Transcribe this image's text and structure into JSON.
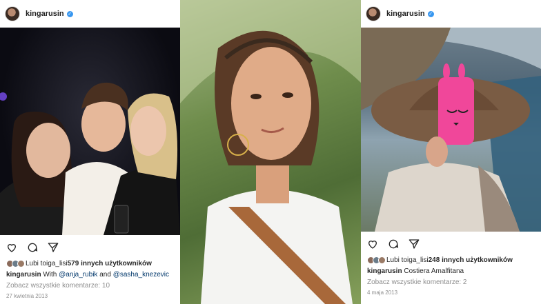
{
  "left_post": {
    "username": "kingarusin",
    "likes": {
      "prefix": "Lubi to ",
      "first_liker": "iga_lis",
      "joiner": " i ",
      "others": "579 innych użytkowników"
    },
    "caption": {
      "user": "kingarusin",
      "text": " With ",
      "mention1": "@anja_rubik",
      "and": " and ",
      "mention2": "@sasha_knezevic"
    },
    "comments": "Zobacz wszystkie komentarze: 10",
    "date": "27 kwietnia 2013"
  },
  "right_post": {
    "username": "kingarusin",
    "likes": {
      "prefix": "Lubi to ",
      "first_liker": "iga_lis",
      "joiner": " i ",
      "others": "248 innych użytkowników"
    },
    "caption": {
      "user": "kingarusin",
      "text": " Costiera Amalfitana"
    },
    "comments": "Zobacz wszystkie komentarze: 2",
    "date": "4 maja 2013"
  },
  "icons": [
    "heart-icon",
    "comment-icon",
    "share-icon",
    "verified-icon"
  ],
  "colors": {
    "verified": "#3897f0",
    "mention": "#00376b",
    "muted": "#8e8e8e",
    "phone_case": "#f0479a"
  }
}
